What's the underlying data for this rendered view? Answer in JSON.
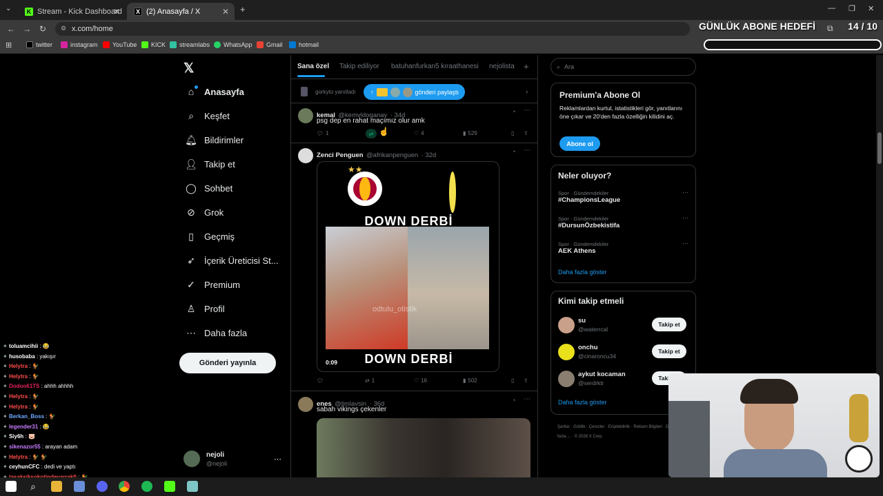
{
  "browser": {
    "tabs": [
      {
        "title": "Stream - Kick Dashboard",
        "active": false
      },
      {
        "title": "(2) Anasayfa / X",
        "active": true
      }
    ],
    "url": "x.com/home",
    "bookmarks": [
      "twitter",
      "instagram",
      "YouTube",
      "KICK",
      "streamlabs",
      "WhatsApp",
      "Gmail",
      "hotmail"
    ]
  },
  "goal": {
    "title": "GÜNLÜK ABONE HEDEFİ",
    "count": "14 / 10"
  },
  "nav": {
    "items": [
      "Anasayfa",
      "Keşfet",
      "Bildirimler",
      "Takip et",
      "Sohbet",
      "Grok",
      "Geçmiş",
      "İçerik Üreticisi St...",
      "Premium",
      "Profil",
      "Daha fazla"
    ],
    "post_button": "Gönderi yayınla",
    "account": {
      "name": "nejoli",
      "handle": "@nejoli"
    }
  },
  "center": {
    "tabs": [
      "Sana özel",
      "Takip ediliyor",
      "batuhanfurkan5 kıraathanesi",
      "nejolista"
    ],
    "reply_hint": "gorkyto yanıtladı",
    "share_pill": "gönderi paylaştı",
    "tweets": [
      {
        "name": "kemal",
        "handle": "@kemvldoganay",
        "age": "· 34d",
        "text": "psg dep en rahat maçımız olur amk",
        "replies": "1",
        "reposts": "",
        "likes": "4",
        "views": "529"
      },
      {
        "name": "Zenci Penguen",
        "handle": "@afrikanpenguen",
        "age": "· 32d",
        "text": "",
        "media_top": "DOWN DERBİ",
        "media_bottom": "DOWN DERBİ",
        "media_watermark": "odtulu_otistik",
        "video_time": "0:09",
        "replies": "",
        "reposts": "1",
        "likes": "16",
        "views": "502"
      },
      {
        "name": "enes",
        "handle": "@limlavsin",
        "age": "· 36d",
        "text": "sabah vikings çekenler"
      }
    ]
  },
  "right": {
    "search_placeholder": "Ara",
    "premium": {
      "title": "Premium'a Abone Ol",
      "body": "Reklamlardan kurtul, istatistikleri gör, yanıtlarını öne çıkar ve 20'den fazla özelliğin kilidini aç.",
      "button": "Abone ol"
    },
    "trends": {
      "title": "Neler oluyor?",
      "items": [
        {
          "category": "Spor · Gündemdekiler",
          "name": "#ChampionsLeague"
        },
        {
          "category": "Spor · Gündemdekiler",
          "name": "#DursunÖzbekistifa"
        },
        {
          "category": "Spor · Gündemdekiler",
          "name": "AEK Athens"
        }
      ],
      "show_more": "Daha fazla göster"
    },
    "who_to_follow": {
      "title": "Kimi takip etmeli",
      "items": [
        {
          "name": "su",
          "handle": "@waterrcal",
          "button": "Takip et"
        },
        {
          "name": "onchu",
          "handle": "@cinaroncu34",
          "button": "Takip et"
        },
        {
          "name": "aykut kocaman",
          "handle": "@serdrktr",
          "button": "Takip et"
        }
      ],
      "show_more": "Daha fazla göster"
    },
    "footer": [
      "Şartlar",
      "Gizlilik",
      "Çerezler",
      "Erişilebilirlik",
      "Reklam Bilgileri",
      "Daha fazla ...",
      "© 2026 X Corp."
    ]
  },
  "chat": [
    {
      "user": "toluamcihii",
      "msg": ": 😂",
      "color": "#ffffff"
    },
    {
      "user": "husobaba",
      "msg": ": yakışır",
      "color": "#ffffff"
    },
    {
      "user": "Helytra",
      "msg": ": 🐓",
      "color": "#ff4d4d"
    },
    {
      "user": "Helytra",
      "msg": ": 🐓",
      "color": "#ff4d4d"
    },
    {
      "user": "Dodoo61TS",
      "msg": ": ahhh ahhhh",
      "color": "#e0245e"
    },
    {
      "user": "Helytra",
      "msg": ": 🐓",
      "color": "#ff4d4d"
    },
    {
      "user": "Helytra",
      "msg": ": 🐓",
      "color": "#ff4d4d"
    },
    {
      "user": "Berkan_Boss",
      "msg": ": 🐓",
      "color": "#6fa8ff"
    },
    {
      "user": "legender31",
      "msg": ": 😂",
      "color": "#c77dff"
    },
    {
      "user": "Siy6h",
      "msg": ": 🐷",
      "color": "#ffffff"
    },
    {
      "user": "sikenazor55",
      "msg": ": arayan adam",
      "color": "#c77dff"
    },
    {
      "user": "Helytra",
      "msg": ": 🐓 🐓",
      "color": "#ff4d4d"
    },
    {
      "user": "ceyhunCFC",
      "msg": ": dedi ve yaptı",
      "color": "#ffffff"
    },
    {
      "user": "taşaksiksokotindeyarrak0",
      "msg": ": 🐓",
      "color": "#ff4d4d"
    }
  ],
  "colors": {
    "x_blue": "#1d9bf0",
    "border": "#2f3336",
    "muted": "#71767b",
    "retweet_green": "#00ba7c"
  }
}
